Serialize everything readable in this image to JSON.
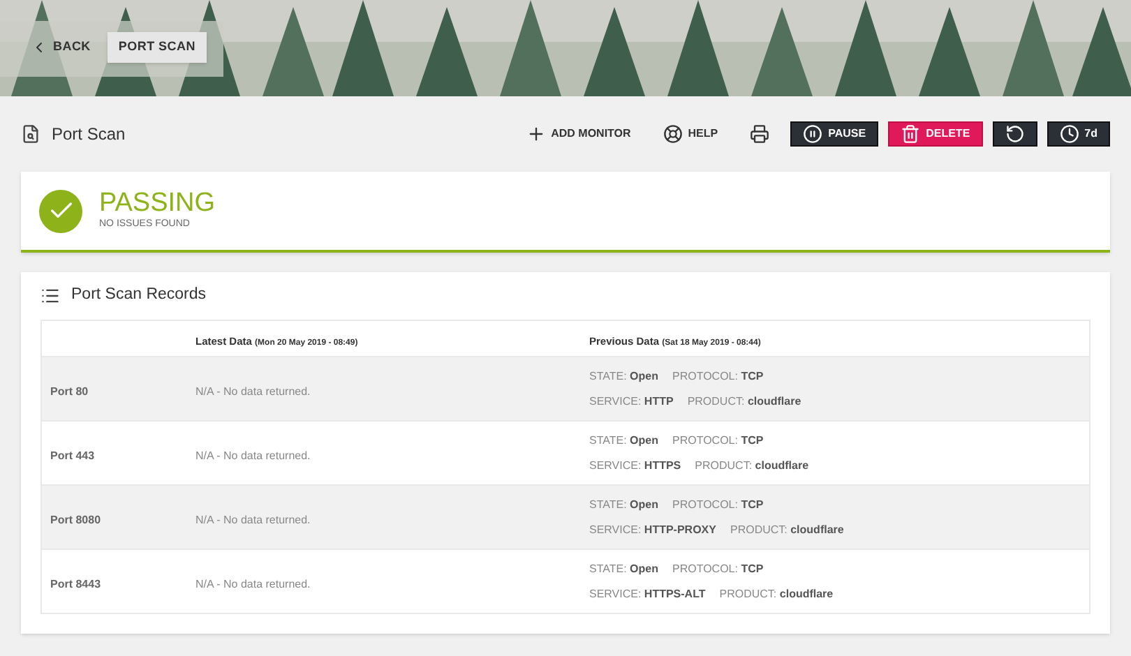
{
  "breadcrumb": [
    {
      "label": "BACK",
      "kind": "back",
      "selected": false
    },
    {
      "label": "PORT SCAN",
      "kind": "current",
      "selected": true
    }
  ],
  "page_title": "Port Scan",
  "toolbar": [
    {
      "label": "ADD MONITOR",
      "kind": "plus"
    },
    {
      "label": "HELP",
      "kind": "help"
    },
    {
      "kind": "print"
    },
    {
      "label": "PAUSE",
      "kind": "pause"
    },
    {
      "label": "DELETE",
      "kind": "delete"
    },
    {
      "kind": "refresh"
    },
    {
      "label": "7d",
      "kind": "clock"
    }
  ],
  "status": {
    "title": "PASSING",
    "subtitle": "NO ISSUES FOUND",
    "passing": true
  },
  "records": {
    "title": "Port Scan Records",
    "columns": [
      {},
      {
        "label": "Latest Data",
        "note": "(Mon 20 May 2019 - 08:49)"
      },
      {
        "label": "Previous Data",
        "note": "(Sat 18 May 2019 - 08:44)"
      }
    ],
    "rows": [
      {
        "port": "Port 80",
        "latest": "N/A - No data returned.",
        "previous": [
          [
            "STATE: **Open**",
            "PROTOCOL: **TCP**"
          ],
          [
            "SERVICE: **HTTP**",
            "PRODUCT: **cloudflare**"
          ]
        ]
      },
      {
        "port": "Port 443",
        "latest": "N/A - No data returned.",
        "previous": [
          [
            "STATE: **Open**",
            "PROTOCOL: **TCP**"
          ],
          [
            "SERVICE: **HTTPS**",
            "PRODUCT: **cloudflare**"
          ]
        ]
      },
      {
        "port": "Port 8080",
        "latest": "N/A - No data returned.",
        "previous": [
          [
            "STATE: **Open**",
            "PROTOCOL: **TCP**"
          ],
          [
            "SERVICE: **HTTP-PROXY**",
            "PRODUCT: **cloudflare**"
          ]
        ]
      },
      {
        "port": "Port 8443",
        "latest": "N/A - No data returned.",
        "previous": [
          [
            "STATE: **Open**",
            "PROTOCOL: **TCP**"
          ],
          [
            "SERVICE: **HTTPS-ALT**",
            "PRODUCT: **cloudflare**"
          ]
        ]
      }
    ]
  }
}
